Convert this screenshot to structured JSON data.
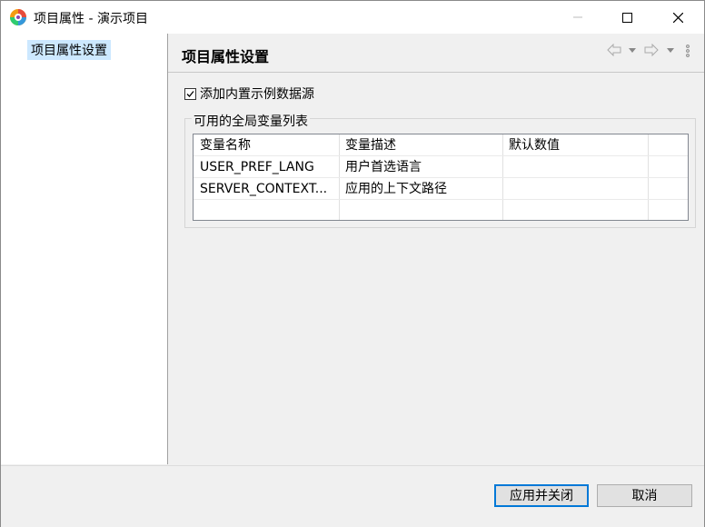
{
  "window": {
    "title": "项目属性 - 演示项目"
  },
  "sidebar": {
    "items": [
      {
        "label": "项目属性设置",
        "selected": true
      }
    ]
  },
  "page": {
    "title": "项目属性设置",
    "checkbox": {
      "label": "添加内置示例数据源",
      "checked": true
    },
    "group": {
      "label": "可用的全局变量列表"
    },
    "table": {
      "columns": [
        "变量名称",
        "变量描述",
        "默认数值",
        ""
      ],
      "rows": [
        [
          "USER_PREF_LANG",
          "用户首选语言",
          "",
          ""
        ],
        [
          "SERVER_CONTEXT...",
          "应用的上下文路径",
          "",
          ""
        ]
      ]
    }
  },
  "buttons": {
    "apply_close": "应用并关闭",
    "cancel": "取消"
  },
  "colors": {
    "selection": "#cce8ff",
    "accent": "#0078d7"
  },
  "icons": [
    "app-icon",
    "minimize-icon",
    "maximize-icon",
    "close-icon",
    "back-arrow-icon",
    "forward-arrow-icon",
    "dropdown-icon",
    "more-vertical-icon",
    "checkbox-checked-icon"
  ]
}
